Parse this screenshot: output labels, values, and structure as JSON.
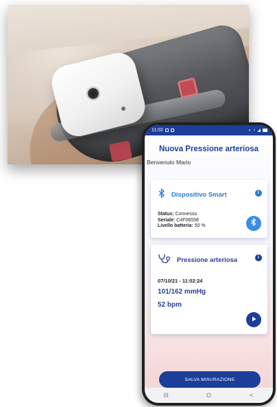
{
  "status_bar": {
    "time": "11:02",
    "left_icons": [
      "notification-icon",
      "notification-icon"
    ],
    "right_icons": [
      "mute-icon",
      "wifi-icon",
      "signal-icon",
      "battery-icon"
    ]
  },
  "app": {
    "title": "Nuova Pressione arteriosa",
    "welcome": "Benvenuto Mario"
  },
  "device_card": {
    "title": "Dispositivo Smart",
    "icon": "bluetooth-icon",
    "info_icon": "info-icon",
    "status_label": "Status:",
    "status_value": "Connesso",
    "serial_label": "Seriale:",
    "serial_value": "C4F0655E",
    "battery_label": "Livello batteria:",
    "battery_value": "50 %",
    "action_icon": "bluetooth-disconnect-icon"
  },
  "pressure_card": {
    "title": "Pressione arteriosa",
    "icon": "stethoscope-icon",
    "info_icon": "info-icon",
    "datetime": "07/10/21 - 11:02:24",
    "pressure": "101/162 mmHg",
    "pulse": "52 bpm",
    "action_icon": "play-icon"
  },
  "save_button": {
    "label": "SALVA MISURAZIONE"
  },
  "nav": {
    "recents": "III",
    "home": "O",
    "back": "<"
  },
  "colors": {
    "primary": "#1c3e9a",
    "accent": "#2a7cd6",
    "bluetooth_button": "#3b8ee2"
  }
}
